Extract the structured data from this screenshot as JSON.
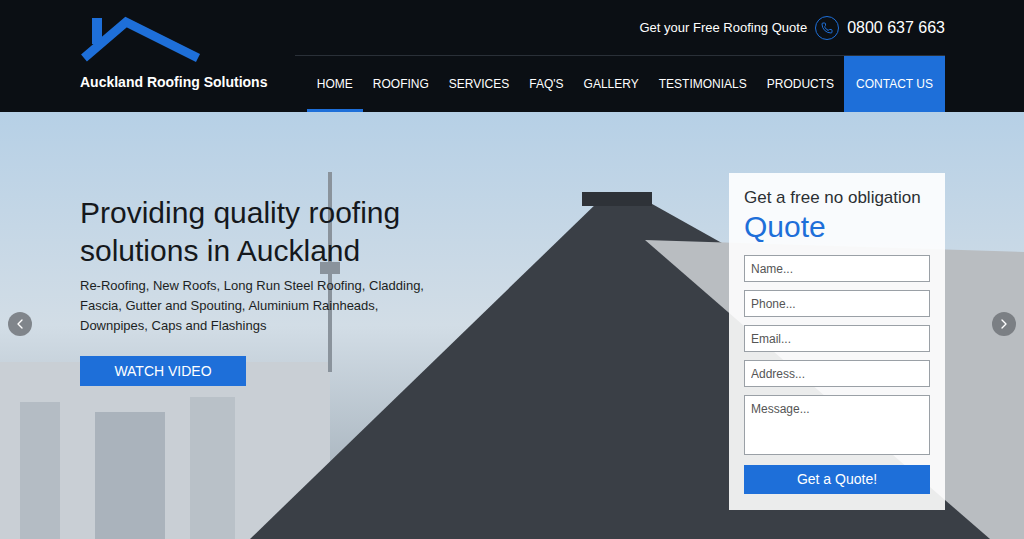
{
  "header": {
    "logo_text": "Auckland Roofing Solutions",
    "quote_prompt": "Get your Free Roofing Quote",
    "phone": "0800 637 663"
  },
  "nav": [
    {
      "label": "HOME",
      "selected": true,
      "kind": "link"
    },
    {
      "label": "ROOFING",
      "selected": false,
      "kind": "link"
    },
    {
      "label": "SERVICES",
      "selected": false,
      "kind": "link"
    },
    {
      "label": "FAQ'S",
      "selected": false,
      "kind": "link"
    },
    {
      "label": "GALLERY",
      "selected": false,
      "kind": "link"
    },
    {
      "label": "TESTIMONIALS",
      "selected": false,
      "kind": "link"
    },
    {
      "label": "PRODUCTS",
      "selected": false,
      "kind": "link"
    },
    {
      "label": "CONTACT US",
      "selected": false,
      "kind": "cta"
    }
  ],
  "hero": {
    "heading": "Providing quality roofing solutions in Auckland",
    "subheading": "Re-Roofing, New Roofs, Long Run Steel Roofing, Cladding, Fascia, Gutter and Spouting, Aluminium Rainheads, Downpipes, Caps and Flashings",
    "button": "WATCH VIDEO"
  },
  "quote_form": {
    "title": "Get a free no obligation",
    "title_emphasis": "Quote",
    "fields": [
      {
        "placeholder": "Name...",
        "kind": "input"
      },
      {
        "placeholder": "Phone...",
        "kind": "input"
      },
      {
        "placeholder": "Email...",
        "kind": "input"
      },
      {
        "placeholder": "Address...",
        "kind": "input"
      },
      {
        "placeholder": "Message...",
        "kind": "textarea"
      }
    ],
    "submit": "Get a Quote!"
  }
}
